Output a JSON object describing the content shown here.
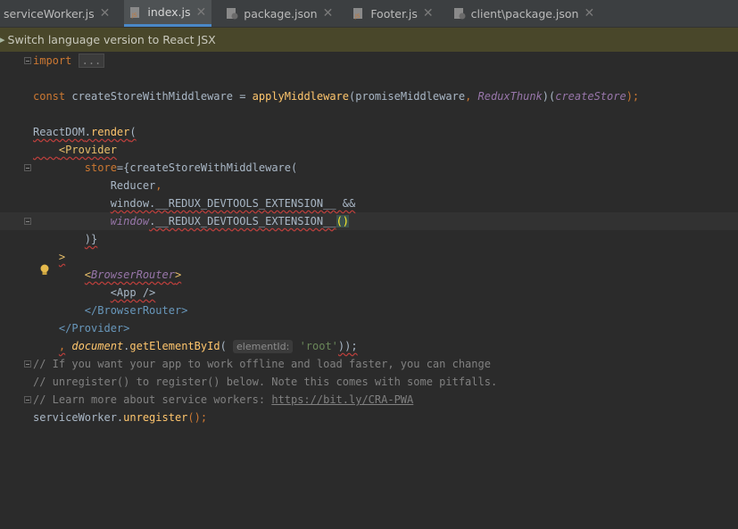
{
  "tabs": [
    {
      "name": "serviceWorker.js",
      "icon": "js-file-icon",
      "active": false
    },
    {
      "name": "index.js",
      "icon": "js-file-icon",
      "active": true
    },
    {
      "name": "package.json",
      "icon": "json-file-icon",
      "active": false
    },
    {
      "name": "Footer.js",
      "icon": "js-file-icon",
      "active": false
    },
    {
      "name": "client\\package.json",
      "icon": "json-file-icon",
      "active": false
    }
  ],
  "banner": {
    "text": "Switch language version to React JSX"
  },
  "code": {
    "l1_import": "import",
    "l1_folded": "...",
    "l3_const": "const",
    "l3_var": " createStoreWithMiddleware = ",
    "l3_fn": "applyMiddleware",
    "l3_open": "(promiseMiddleware",
    "l3_comma": ", ",
    "l3_thunk": "ReduxThunk",
    "l3_mid": ")(",
    "l3_create": "createStore",
    "l3_end": ");",
    "l5_obj": "ReactDOM",
    "l5_dot": ".",
    "l5_fn": "render",
    "l5_paren": "(",
    "l6_lt": "<",
    "l6_tag": "Provider",
    "l7_attr": "store",
    "l7_rest": "={createStoreWithMiddleware(",
    "l8_text": "Reducer",
    "l8_comma": ",",
    "l9_text": "window.__REDUX_DEVTOOLS_EXTENSION__ &&",
    "l10_win": "window",
    "l10_rest": ".__REDUX_DEVTOOLS_EXTENSION__",
    "l10_paren": "()",
    "l11_text": ")}",
    "l12_text": ">",
    "l13_lt": "<",
    "l13_tag": "BrowserRouter",
    "l13_gt": ">",
    "l14_text": "<App />",
    "l15_text": "</BrowserRouter>",
    "l16_text": "</Provider>",
    "l17_comma": ",",
    "l17_doc": "document",
    "l17_dot": ".",
    "l17_fn": "getElementById",
    "l17_open": "(",
    "l17_hint": "elementId:",
    "l17_str": "'root'",
    "l17_end": "));",
    "l18_text": "// If you want your app to work offline and load faster, you can change",
    "l19_text": "// unregister() to register() below. Note this comes with some pitfalls.",
    "l20_pre": "// Learn more about service workers: ",
    "l20_link": "https://bit.ly/CRA-PWA",
    "l21_obj": "serviceWorker",
    "l21_dot": ".",
    "l21_fn": "unregister",
    "l21_end": "();"
  },
  "colors": {
    "background": "#2b2b2b",
    "keyword": "#cc7832",
    "function": "#ffc66d",
    "string": "#6a8759",
    "comment": "#808080",
    "banner": "#49472a"
  }
}
